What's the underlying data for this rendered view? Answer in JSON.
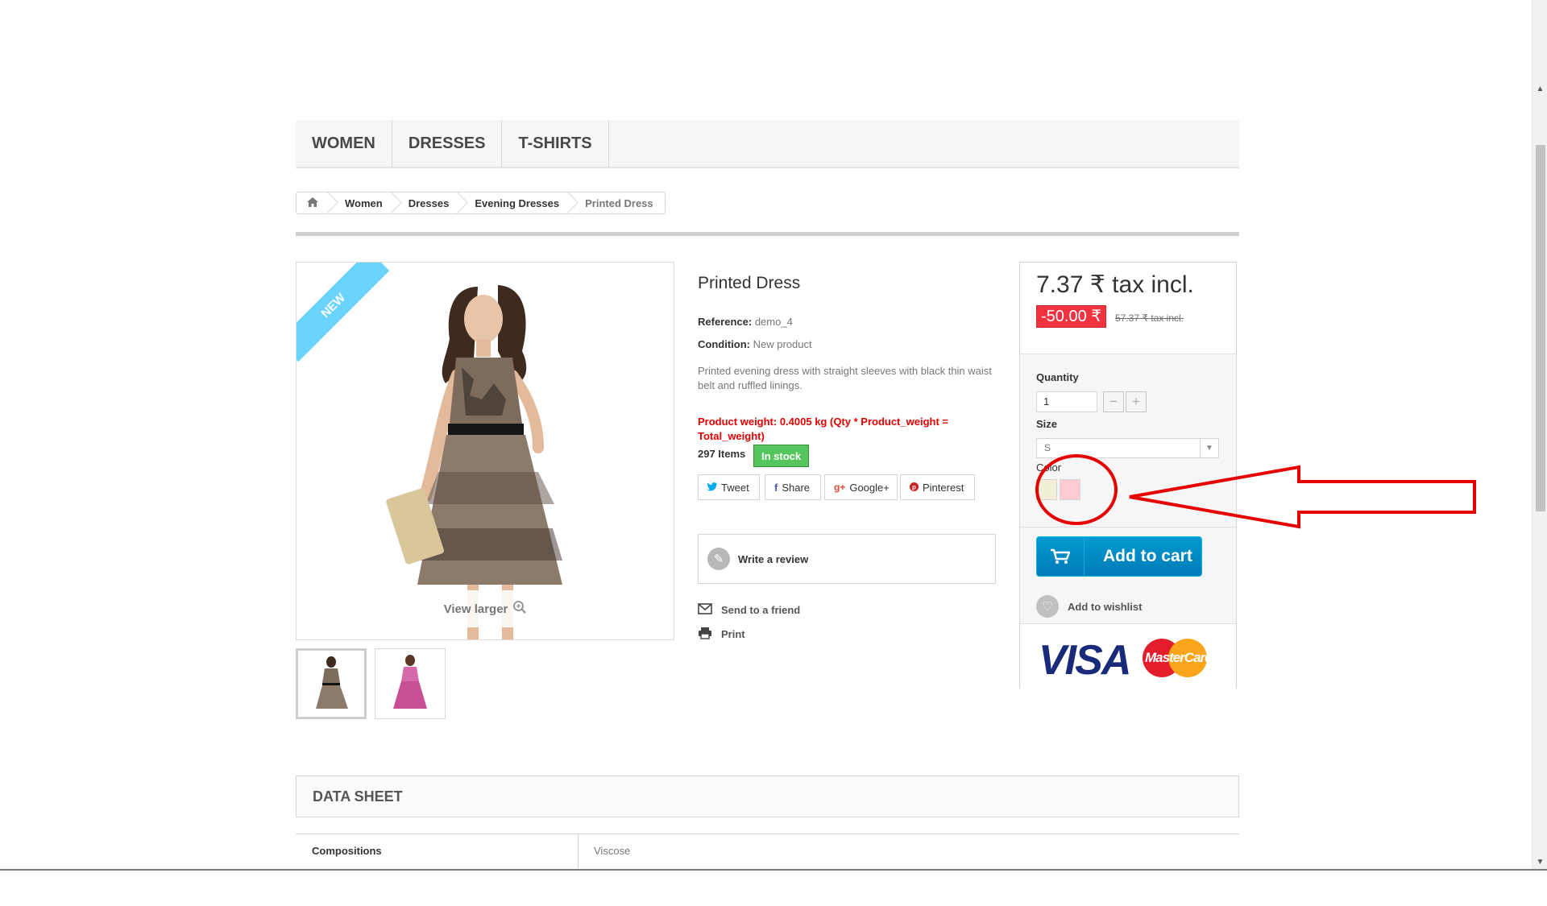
{
  "menu": {
    "items": [
      "WOMEN",
      "DRESSES",
      "T-SHIRTS"
    ]
  },
  "breadcrumb": {
    "items": [
      "Women",
      "Dresses",
      "Evening Dresses",
      "Printed Dress"
    ]
  },
  "product": {
    "new_label": "NEW",
    "view_larger": "View larger",
    "title": "Printed Dress",
    "reference_label": "Reference:",
    "reference_value": "demo_4",
    "condition_label": "Condition:",
    "condition_value": "New product",
    "description": "Printed evening dress with straight sleeves with black thin waist belt and ruffled linings.",
    "weight_text": "Product weight: 0.4005  kg (Qty * Product_weight = Total_weight)",
    "items_count": "297 Items",
    "stock_status": "In stock",
    "social": {
      "tweet": "Tweet",
      "share": "Share",
      "google": "Google+",
      "pinterest": "Pinterest"
    },
    "write_review": "Write a review",
    "send_friend": "Send to a friend",
    "print": "Print"
  },
  "buy": {
    "price": "7.37 ₹ tax incl.",
    "reduction": "-50.00 ₹",
    "old_price": "57.37 ₹ tax incl.",
    "quantity_label": "Quantity",
    "quantity_value": "1",
    "size_label": "Size",
    "size_value": "S",
    "color_label": "Color",
    "colors": [
      "#f1f0d6",
      "#fcccd2"
    ],
    "add_to_cart": "Add to cart",
    "add_to_wishlist": "Add to wishlist",
    "accent_color": "#0079b6",
    "payment": {
      "visa": "VISA",
      "mastercard": "MasterCard"
    }
  },
  "datasheet": {
    "title": "DATA SHEET",
    "rows": [
      {
        "name": "Compositions",
        "value": "Viscose"
      }
    ]
  }
}
